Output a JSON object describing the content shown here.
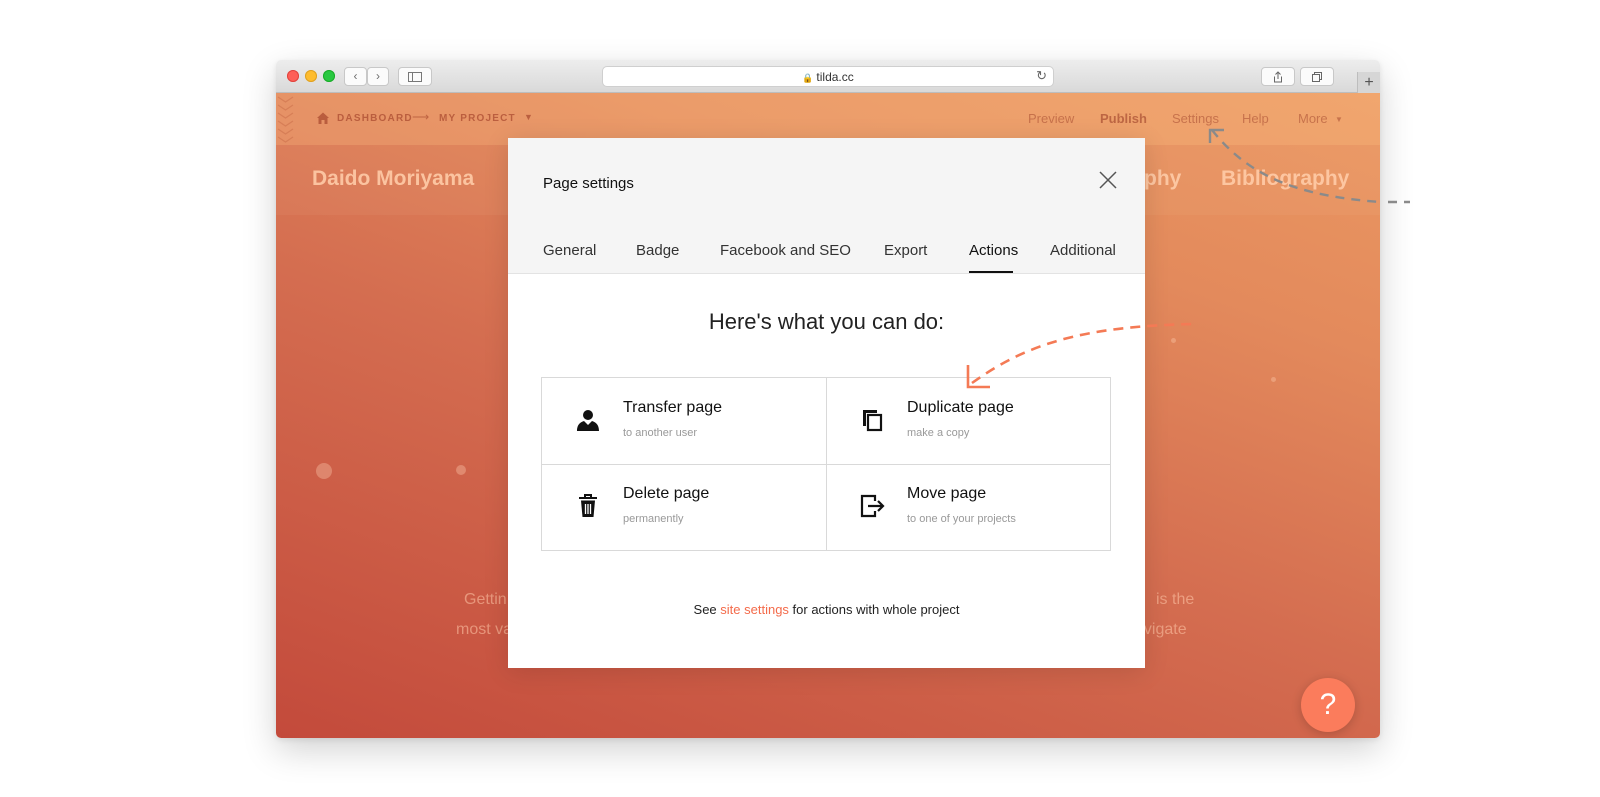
{
  "browser": {
    "url": "tilda.cc"
  },
  "editor_bar": {
    "breadcrumb": [
      "DASHBOARD",
      "MY PROJECT"
    ],
    "actions": [
      "Preview",
      "Publish",
      "Settings",
      "Help",
      "More"
    ]
  },
  "site": {
    "brand": "Daido Moriyama",
    "nav": [
      "phy",
      "Bibliography"
    ],
    "bg_text_left": [
      "Gettin",
      "most va"
    ],
    "bg_text_right": [
      "is the",
      "avigate"
    ]
  },
  "modal": {
    "title": "Page settings",
    "tabs": [
      "General",
      "Badge",
      "Facebook and SEO",
      "Export",
      "Actions",
      "Additional"
    ],
    "active_tab": "Actions",
    "heading": "Here's what you can do:",
    "actions": [
      {
        "title": "Transfer page",
        "subtitle": "to another user",
        "icon": "user-icon"
      },
      {
        "title": "Duplicate page",
        "subtitle": "make a copy",
        "icon": "copy-icon"
      },
      {
        "title": "Delete page",
        "subtitle": "permanently",
        "icon": "trash-icon"
      },
      {
        "title": "Move page",
        "subtitle": "to one of your projects",
        "icon": "move-icon"
      }
    ],
    "footnote": {
      "before": "See ",
      "link": "site settings",
      "after": " for actions with whole project"
    }
  },
  "help_button": {
    "label": "?"
  },
  "colors": {
    "accent": "#f46b4b",
    "fab": "#fb7c5c",
    "annotation_orange": "#f47a55",
    "annotation_gray": "#8a8a8a"
  }
}
